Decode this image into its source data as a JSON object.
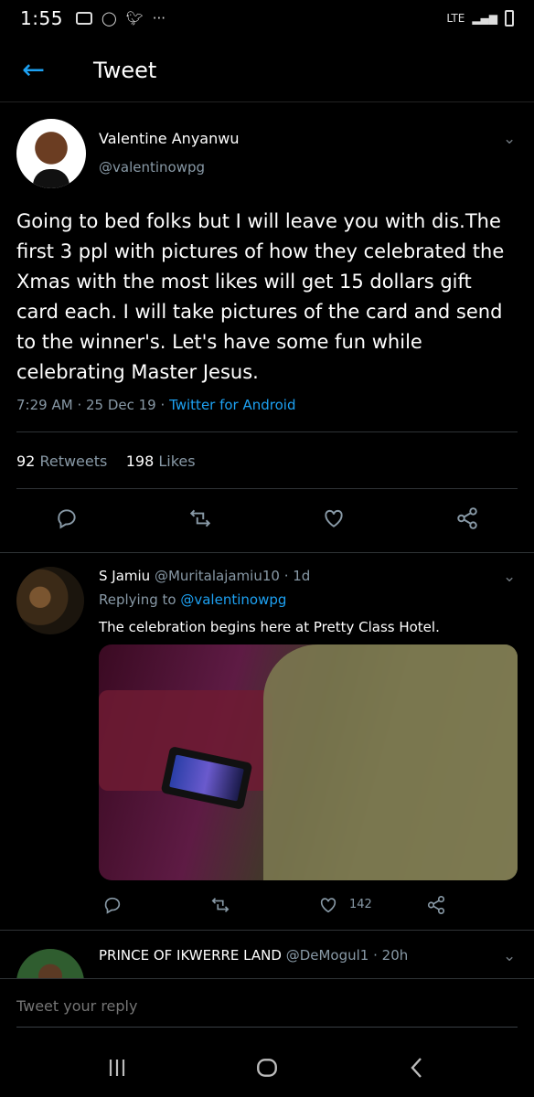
{
  "status_bar": {
    "time": "1:55",
    "network": "LTE"
  },
  "header": {
    "title": "Tweet"
  },
  "tweet": {
    "author_name": "Valentine Anyanwu",
    "author_handle": "@valentinowpg",
    "text": "Going to bed folks but I will leave you with dis.The first 3 ppl with  pictures of how they celebrated the Xmas with the most likes will get 15 dollars gift card each. I will take  pictures of the card and send to the winner's. Let's have some fun while celebrating Master Jesus.",
    "time": "7:29 AM",
    "date": "25 Dec 19",
    "source": "Twitter for Android",
    "retweets_count": "92",
    "retweets_label": "Retweets",
    "likes_count": "198",
    "likes_label": "Likes"
  },
  "reply1": {
    "name": "S Jamiu",
    "handle": "@Muritalajamiu10",
    "age": "1d",
    "replying_label": "Replying to",
    "replying_to": "@valentinowpg",
    "text": "The celebration begins here at Pretty Class Hotel.",
    "like_count": "142"
  },
  "reply2": {
    "name": "PRINCE OF IKWERRE LAND",
    "handle": "@DeMogul1",
    "age": "20h"
  },
  "reply_bar": {
    "placeholder": "Tweet your reply"
  },
  "colors": {
    "accent": "#1da1f2",
    "secondary_text": "#8899a6",
    "background": "#000000"
  }
}
